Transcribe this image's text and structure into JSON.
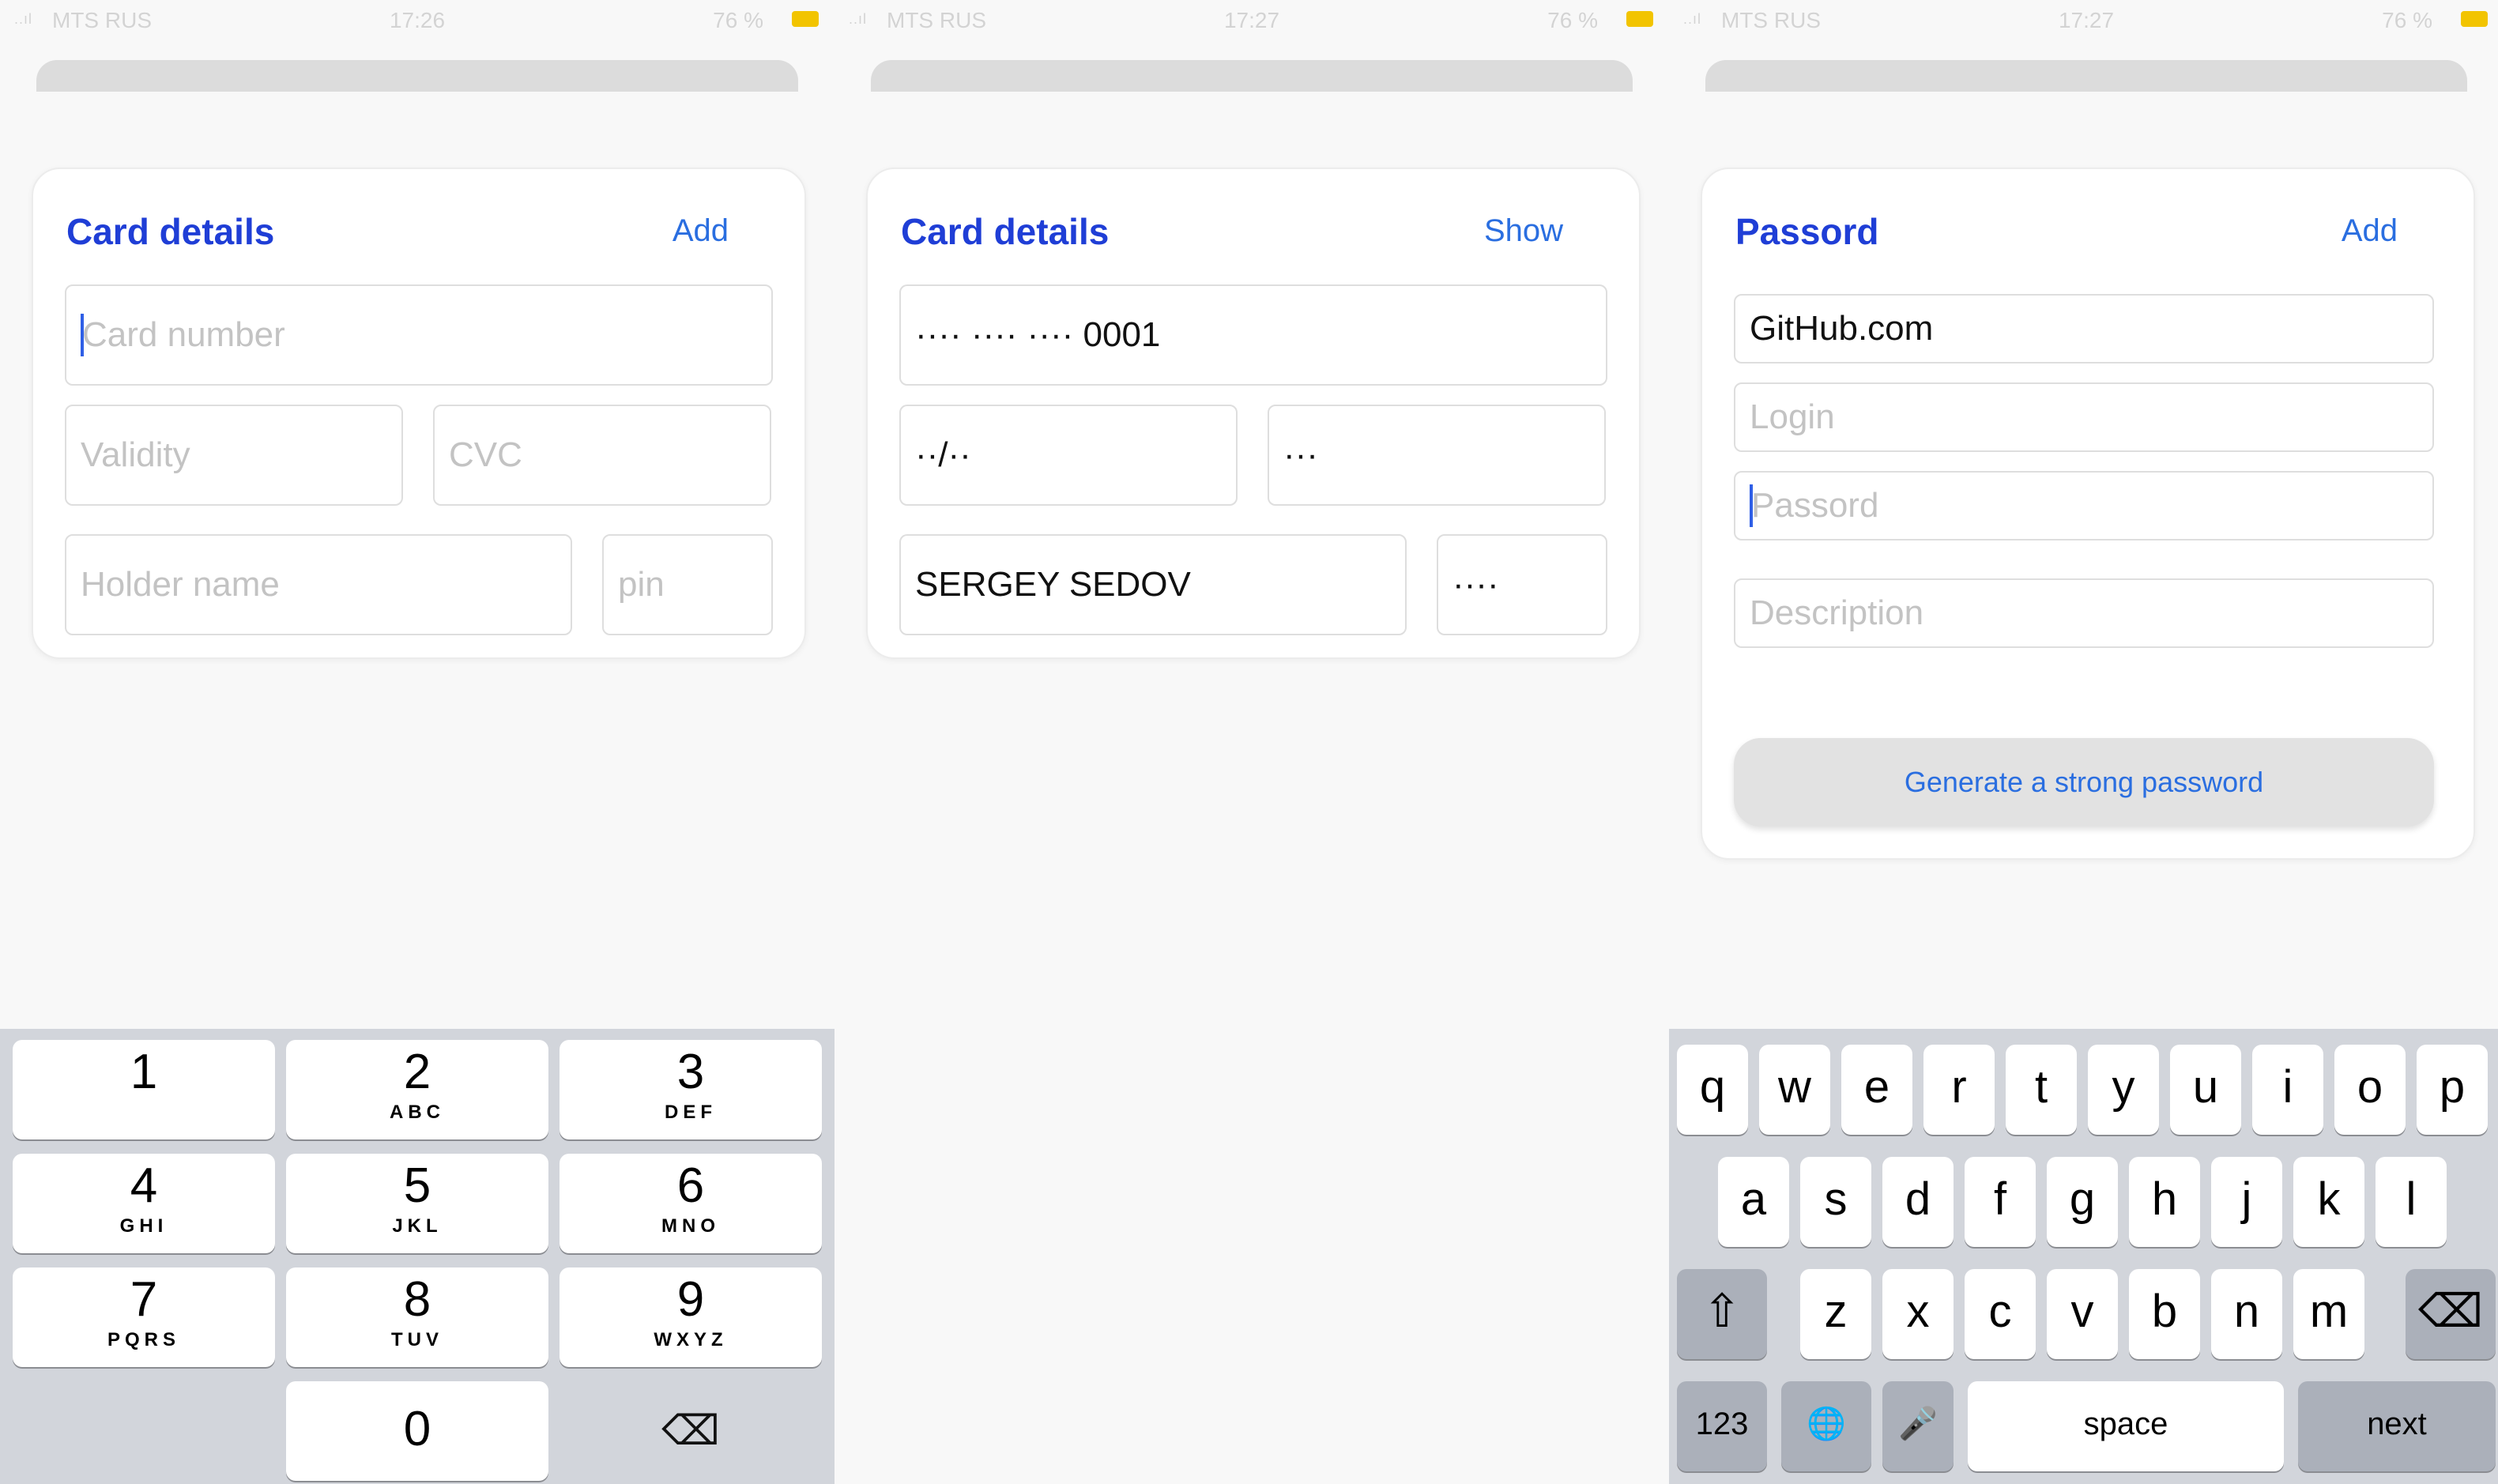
{
  "panels": [
    {
      "status": {
        "signal": "..ıl",
        "carrier": "MTS RUS",
        "time": "17:26",
        "battery": "76 %"
      },
      "title": "Card details",
      "action": "Add",
      "fields": {
        "card_number": "Card number",
        "validity": "Validity",
        "cvc": "CVC",
        "holder_name": "Holder name",
        "pin": "pin"
      },
      "keypad": [
        {
          "num": "1",
          "letters": ""
        },
        {
          "num": "2",
          "letters": "ABC"
        },
        {
          "num": "3",
          "letters": "DEF"
        },
        {
          "num": "4",
          "letters": "GHI"
        },
        {
          "num": "5",
          "letters": "JKL"
        },
        {
          "num": "6",
          "letters": "MNO"
        },
        {
          "num": "7",
          "letters": "PQRS"
        },
        {
          "num": "8",
          "letters": "TUV"
        },
        {
          "num": "9",
          "letters": "WXYZ"
        },
        {
          "num": "0",
          "letters": ""
        }
      ],
      "delete_glyph": "⌫"
    },
    {
      "status": {
        "signal": "..ıl",
        "carrier": "MTS RUS",
        "time": "17:27",
        "battery": "76 %"
      },
      "title": "Card details",
      "action": "Show",
      "fields": {
        "card_number": "···· ···· ···· 0001",
        "validity": "··/··",
        "cvc": "···",
        "holder_name": "SERGEY SEDOV",
        "pin": "····"
      }
    },
    {
      "status": {
        "signal": "..ıl",
        "carrier": "MTS RUS",
        "time": "17:27",
        "battery": "76 %"
      },
      "title": "Passord",
      "action": "Add",
      "fields": {
        "site": "GitHub.com",
        "login": "Login",
        "password": "Passord",
        "description": "Description"
      },
      "generate_button": "Generate a strong password",
      "keyboard": {
        "row1": [
          "q",
          "w",
          "e",
          "r",
          "t",
          "y",
          "u",
          "i",
          "o",
          "p"
        ],
        "row2": [
          "a",
          "s",
          "d",
          "f",
          "g",
          "h",
          "j",
          "k",
          "l"
        ],
        "row3": [
          "z",
          "x",
          "c",
          "v",
          "b",
          "n",
          "m"
        ],
        "shift": "⇧",
        "backspace": "⌫",
        "numbers": "123",
        "globe": "🌐",
        "mic": "🎤",
        "space": "space",
        "next": "next"
      }
    }
  ],
  "colors": {
    "title_blue": "#1f3ed6",
    "link_blue": "#2a6ee0",
    "caret": "#2f5fe6",
    "keyboard_bg": "#d2d5db"
  }
}
